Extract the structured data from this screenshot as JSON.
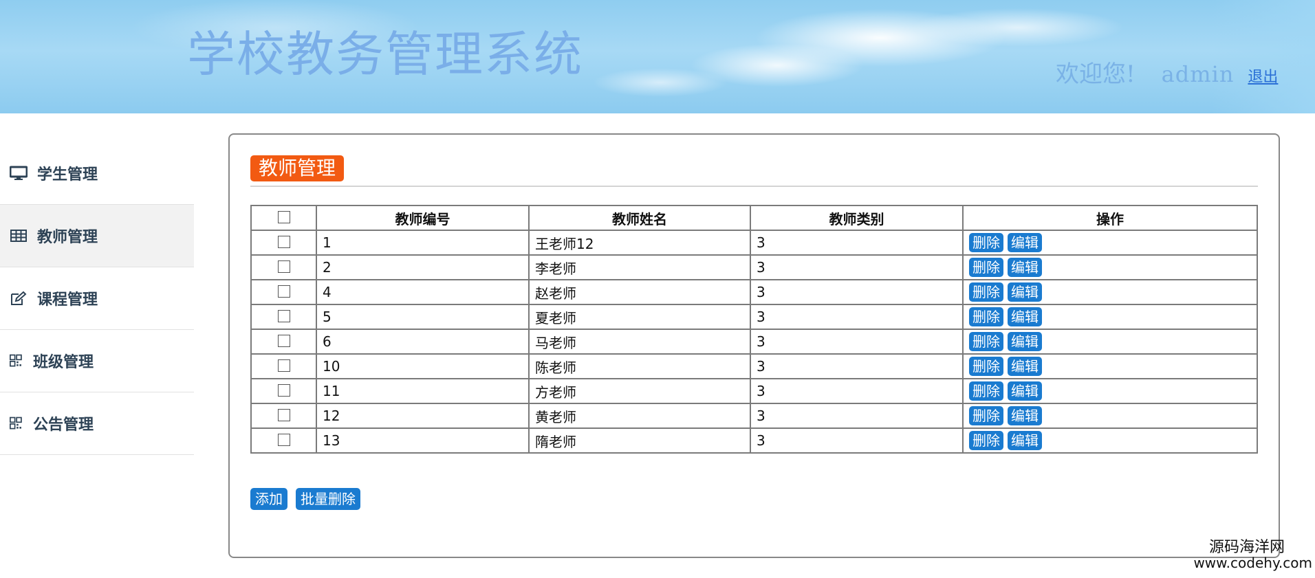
{
  "header": {
    "app_title": "学校教务管理系统",
    "welcome": "欢迎您!",
    "username": "admin",
    "logout_label": "退出"
  },
  "sidebar": {
    "items": [
      {
        "label": "学生管理",
        "icon": "monitor-icon"
      },
      {
        "label": "教师管理",
        "icon": "table-icon",
        "active": true
      },
      {
        "label": "课程管理",
        "icon": "edit-icon"
      },
      {
        "label": "班级管理",
        "icon": "qrcode-icon"
      },
      {
        "label": "公告管理",
        "icon": "qrcode-icon"
      }
    ]
  },
  "main": {
    "title": "教师管理",
    "table": {
      "headers": [
        "教师编号",
        "教师姓名",
        "教师类别",
        "操作"
      ],
      "rows": [
        {
          "id": "1",
          "name": "王老师12",
          "type": "3"
        },
        {
          "id": "2",
          "name": "李老师",
          "type": "3"
        },
        {
          "id": "4",
          "name": "赵老师",
          "type": "3"
        },
        {
          "id": "5",
          "name": "夏老师",
          "type": "3"
        },
        {
          "id": "6",
          "name": "马老师",
          "type": "3"
        },
        {
          "id": "10",
          "name": "陈老师",
          "type": "3"
        },
        {
          "id": "11",
          "name": "方老师",
          "type": "3"
        },
        {
          "id": "12",
          "name": "黄老师",
          "type": "3"
        },
        {
          "id": "13",
          "name": "隋老师",
          "type": "3"
        }
      ],
      "delete_label": "删除",
      "edit_label": "编辑"
    },
    "add_label": "添加",
    "batch_delete_label": "批量删除"
  },
  "watermark": {
    "line1": "源码海洋网",
    "line2": "www.codehy.com"
  },
  "colors": {
    "title_badge": "#f25a12",
    "button": "#1a7bd0",
    "header_title": "#7aaee8"
  }
}
